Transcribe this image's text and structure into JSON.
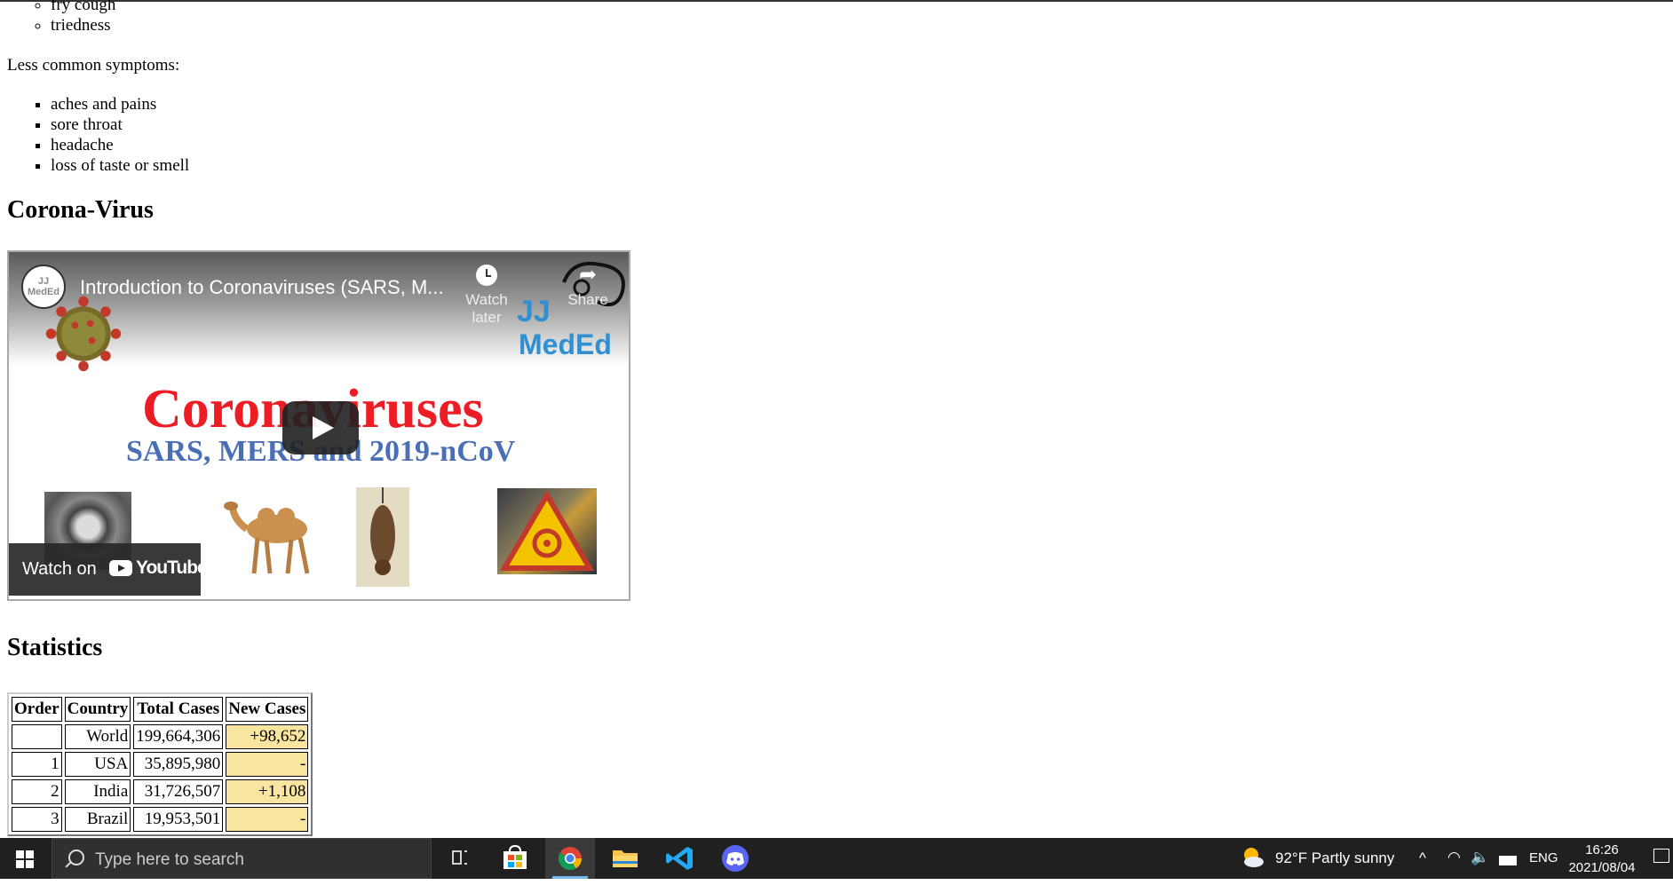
{
  "symptoms": {
    "common_tail": [
      "fry cough",
      "triedness"
    ],
    "less_common_label": "Less common symptoms:",
    "less_common": [
      "aches and pains",
      "sore throat",
      "headache",
      "loss of taste or smell"
    ]
  },
  "sections": {
    "corona_heading": "Corona-Virus",
    "stats_heading": "Statistics"
  },
  "video": {
    "channel_logo_text": "JJ MedEd",
    "title": "Introduction to Coronaviruses (SARS, M...",
    "watch_later": "Watch later",
    "share": "Share",
    "brand_line1": "JJ",
    "brand_line2": "MedEd",
    "thumb_title": "Coronaviruses",
    "thumb_subtitle": "SARS, MERS and 2019-nCoV",
    "watch_on": "Watch on",
    "youtube": "YouTube"
  },
  "table": {
    "headers": [
      "Order",
      "Country",
      "Total Cases",
      "New Cases"
    ],
    "rows": [
      {
        "order": "",
        "country": "World",
        "total": "199,664,306",
        "new": "+98,652"
      },
      {
        "order": "1",
        "country": "USA",
        "total": "35,895,980",
        "new": "-"
      },
      {
        "order": "2",
        "country": "India",
        "total": "31,726,507",
        "new": "+1,108"
      },
      {
        "order": "3",
        "country": "Brazil",
        "total": "19,953,501",
        "new": "-"
      }
    ]
  },
  "taskbar": {
    "search_placeholder": "Type here to search",
    "weather": "92°F  Partly sunny",
    "language": "ENG",
    "time": "16:26",
    "date": "2021/08/04",
    "accent": "#76b9ed"
  }
}
